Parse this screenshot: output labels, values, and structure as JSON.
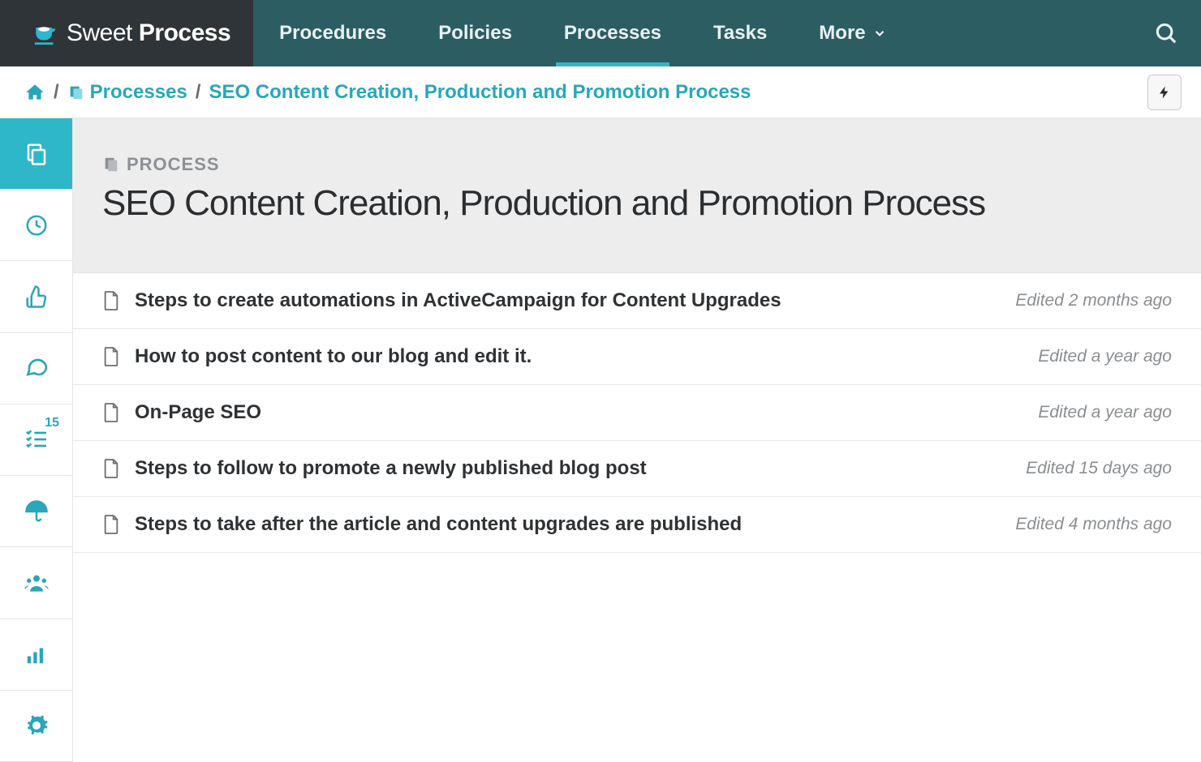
{
  "brand": {
    "light": "Sweet",
    "bold": "Process"
  },
  "nav": {
    "items": [
      {
        "label": "Procedures",
        "active": false
      },
      {
        "label": "Policies",
        "active": false
      },
      {
        "label": "Processes",
        "active": true
      },
      {
        "label": "Tasks",
        "active": false
      },
      {
        "label": "More",
        "active": false,
        "has_chevron": true
      }
    ]
  },
  "breadcrumb": {
    "link_label": "Processes",
    "current": "SEO Content Creation, Production and Promotion Process"
  },
  "sidebar": {
    "items": [
      {
        "name": "copy",
        "active": true
      },
      {
        "name": "clock",
        "active": false
      },
      {
        "name": "thumbs-up",
        "active": false
      },
      {
        "name": "comments",
        "active": false
      },
      {
        "name": "checklist",
        "active": false,
        "badge": "15"
      },
      {
        "name": "umbrella",
        "active": false
      },
      {
        "name": "users",
        "active": false
      },
      {
        "name": "stats",
        "active": false
      },
      {
        "name": "gear",
        "active": false
      }
    ]
  },
  "header": {
    "kicker": "PROCESS",
    "title": "SEO Content Creation, Production and Promotion Process"
  },
  "steps": [
    {
      "title": "Steps to create automations in ActiveCampaign for Content Upgrades",
      "meta": "Edited 2 months ago"
    },
    {
      "title": "How to post content to our blog and edit it.",
      "meta": "Edited a year ago"
    },
    {
      "title": "On-Page SEO",
      "meta": "Edited a year ago"
    },
    {
      "title": "Steps to follow to promote a newly published blog post",
      "meta": "Edited 15 days ago"
    },
    {
      "title": "Steps to take after the article and content upgrades are published",
      "meta": "Edited 4 months ago"
    }
  ]
}
